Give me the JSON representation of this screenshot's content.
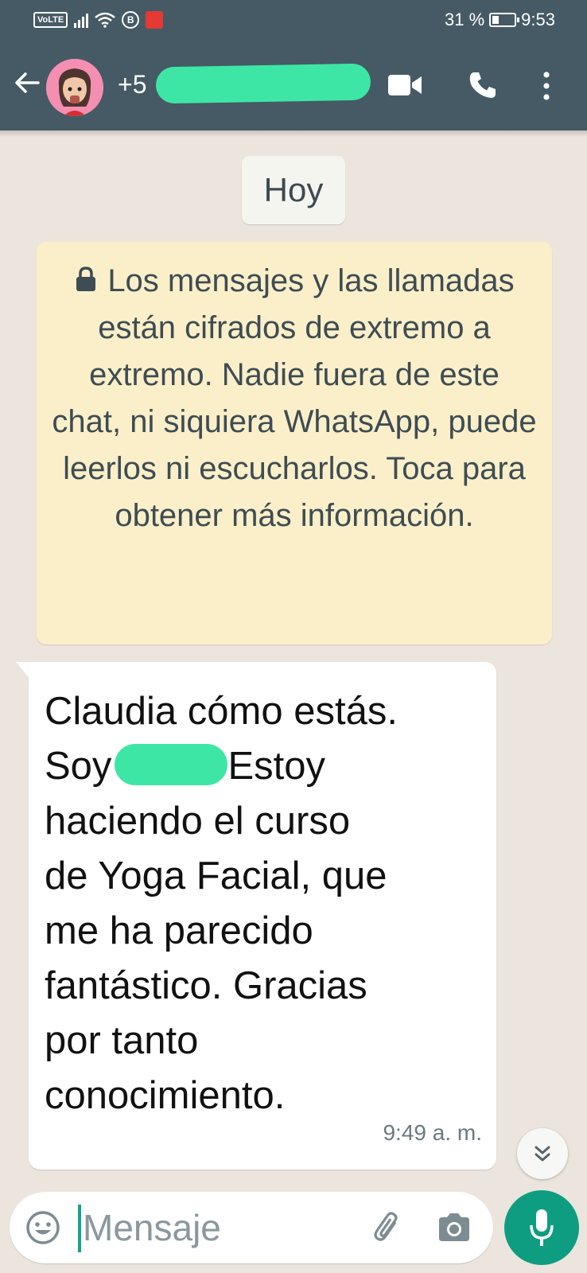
{
  "status_bar": {
    "network_badge": "VoLTE",
    "bluetooth_glyph": "B",
    "battery_level": "31 %",
    "battery_fraction": 0.31,
    "time": "9:53"
  },
  "header": {
    "contact_prefix": "+5",
    "icons": [
      "back-arrow-icon",
      "video-call-icon",
      "voice-call-icon",
      "more-options-icon"
    ]
  },
  "chat": {
    "date_chip": "Hoy",
    "encryption_notice": "Los mensajes y las llamadas están cifrados de extremo a extremo. Nadie fuera de este chat, ni siquiera WhatsApp, puede leerlos ni escucharlos. Toca para obtener más información.",
    "message": {
      "line1": "Claudia cómo estás.",
      "line2_start": "Soy",
      "line2_end": "Estoy",
      "rest": "haciendo el curso\nde Yoga Facial,  que\nme ha parecido\nfantástico.  Gracias\npor tanto\nconocimiento.",
      "time": "9:49 a. m."
    }
  },
  "composer": {
    "placeholder": "Mensaje"
  },
  "colors": {
    "header": "#455a64",
    "chat_background": "#ece5dd",
    "notice_background": "#fbefc9",
    "accent_green": "#0f9d82",
    "redaction": "#3ee6a6"
  }
}
